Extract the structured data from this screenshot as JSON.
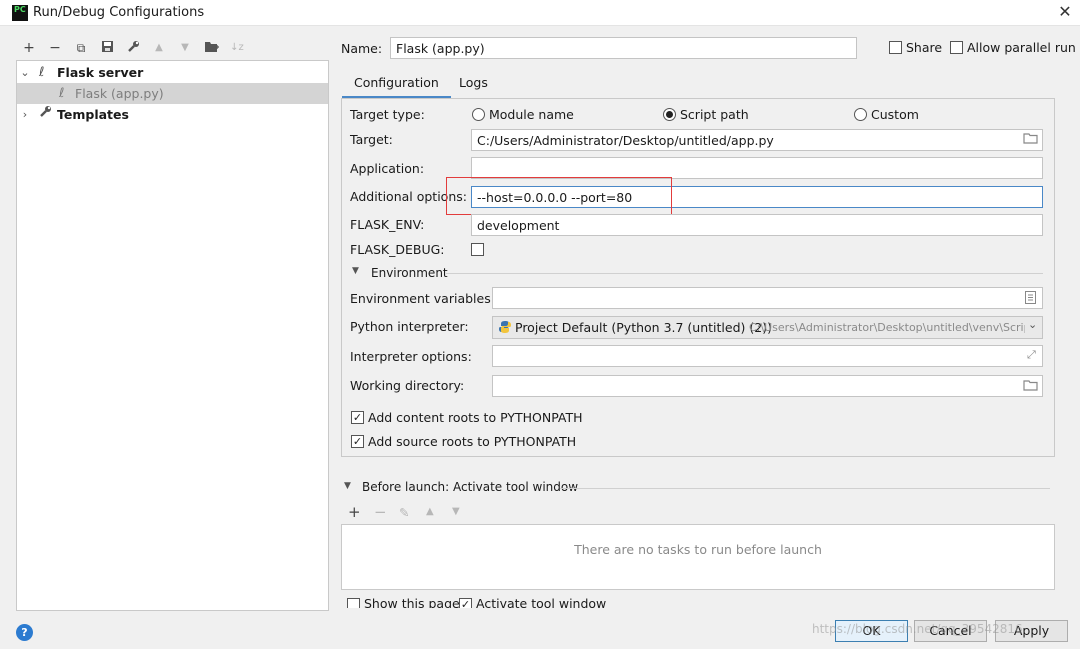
{
  "window": {
    "title": "Run/Debug Configurations",
    "app_icon": "PC"
  },
  "toolbar": {
    "add": "+",
    "remove": "−",
    "copy": "⧉",
    "save": "💾",
    "edit": "🔧",
    "up": "▲",
    "down": "▼",
    "folder": "📁",
    "sort": "↓z"
  },
  "tree": {
    "group_label": "Flask server",
    "item_label": "Flask (app.py)",
    "templates_label": "Templates"
  },
  "header": {
    "name_label": "Name:",
    "name_value": "Flask (app.py)",
    "share_label": "Share",
    "parallel_label": "Allow parallel run"
  },
  "tabs": [
    "Configuration",
    "Logs"
  ],
  "config": {
    "target_type_label": "Target type:",
    "radio_module": "Module name",
    "radio_script": "Script path",
    "radio_custom": "Custom",
    "target_label": "Target:",
    "target_value": "C:/Users/Administrator/Desktop/untitled/app.py",
    "application_label": "Application:",
    "application_value": "",
    "additional_label": "Additional options:",
    "additional_value": "--host=0.0.0.0 --port=80",
    "flask_env_label": "FLASK_ENV:",
    "flask_env_value": "development",
    "flask_debug_label": "FLASK_DEBUG:",
    "environment_label": "Environment",
    "env_vars_label": "Environment variables:",
    "interpreter_label": "Python interpreter:",
    "interpreter_value": "Project Default (Python 3.7 (untitled) (2))",
    "interpreter_path": "C:\\Users\\Administrator\\Desktop\\untitled\\venv\\Scrip",
    "interp_options_label": "Interpreter options:",
    "working_dir_label": "Working directory:",
    "content_roots_label": "Add content roots to PYTHONPATH",
    "source_roots_label": "Add source roots to PYTHONPATH"
  },
  "before_launch": {
    "label": "Before launch: Activate tool window",
    "empty_text": "There are no tasks to run before launch",
    "show_page_label": "Show this page",
    "activate_label": "Activate tool window"
  },
  "buttons": {
    "ok": "OK",
    "cancel": "Cancel",
    "apply": "Apply"
  },
  "watermark": "https://blog.csdn.net/qq_39542816",
  "colors": {
    "accent": "#4a88c7",
    "highlight_box": "#e23c3c"
  }
}
